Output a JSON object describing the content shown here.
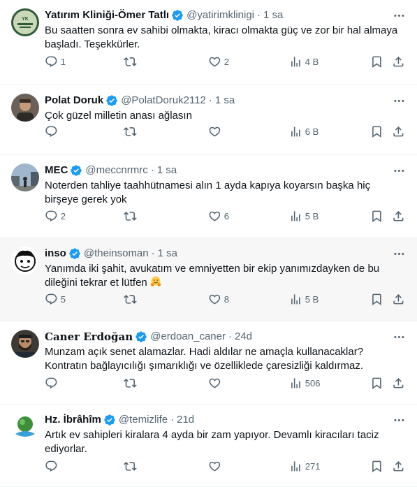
{
  "tweets": [
    {
      "name": "Yatırım Kliniği-Ömer Tatlı",
      "handle": "@yatirimklinigi",
      "time": "1 sa",
      "text_lines": [
        "Bu saatten sonra ev sahibi olmakta, kiracı olmakta güç ve zor bir hal almaya",
        "başladı. Teşekkürler."
      ],
      "replies": "1",
      "retweets": "",
      "likes": "2",
      "views": "4 B",
      "avatar": "green-logo-avatar"
    },
    {
      "name": "Polat Doruk",
      "handle": "@PolatDoruk2112",
      "time": "1 sa",
      "text_lines": [
        "Çok güzel milletin anası ağlasın"
      ],
      "replies": "",
      "retweets": "",
      "likes": "",
      "views": "6 B",
      "avatar": "portrait-avatar"
    },
    {
      "name": "MEC",
      "handle": "@meccnrmrc",
      "time": "1 sa",
      "text_lines": [
        "Noterden tahliye taahhütnamesi alın 1 ayda kapıya koyarsın başka hiç",
        "birşeye gerek yok"
      ],
      "replies": "2",
      "retweets": "",
      "likes": "6",
      "views": "5 B",
      "avatar": "street-photo-avatar"
    },
    {
      "name": "inso",
      "handle": "@theinsoman",
      "time": "1 sa",
      "text_lines": [
        "Yanımda iki şahit, avukatım ve emniyetten bir ekip yanımızdayken de bu",
        "dileğini tekrar et lütfen"
      ],
      "replies": "5",
      "retweets": "",
      "likes": "8",
      "views": "5 B",
      "avatar": "cartoon-face-avatar",
      "emoji": "hugging-face-emoji"
    },
    {
      "name": "Caner Erdoğan",
      "handle": "@erdoan_caner",
      "time": "24d",
      "text_lines": [
        "Munzam açık senet alamazlar. Hadi aldılar ne amaçla kullanacaklar?",
        "Kontratın bağlayıcılığı şımarıklığı ve özelliklede çaresizliği kaldırmaz."
      ],
      "replies": "",
      "retweets": "",
      "likes": "",
      "views": "506",
      "avatar": "bearded-man-avatar"
    },
    {
      "name": "Hz. İbrâhîm",
      "handle": "@temizlife",
      "time": "21d",
      "text_lines": [
        "Artık ev sahipleri kiralara 4 ayda bir zam yapıyor. Devamlı kiracıları taciz",
        "ediyorlar."
      ],
      "replies": "",
      "retweets": "",
      "likes": "",
      "views": "271",
      "avatar": "nature-logo-avatar"
    }
  ],
  "colors": {
    "verified": "#1d9bf0",
    "secondary_text": "#536471",
    "primary_text": "#0f1419",
    "divider": "#eff3f4",
    "hover_bg": "#f7f7f7"
  },
  "icons": [
    "reply-icon",
    "retweet-icon",
    "like-icon",
    "views-icon",
    "bookmark-icon",
    "share-icon",
    "more-icon",
    "verified-badge-icon"
  ]
}
